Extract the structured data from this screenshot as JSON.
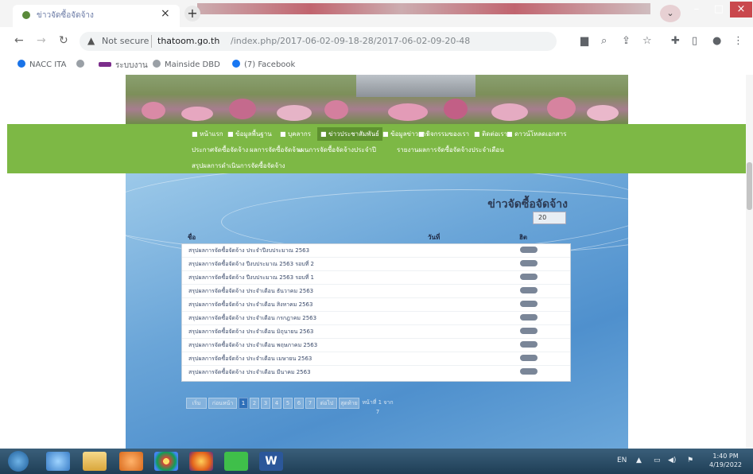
{
  "browser": {
    "tab_title": "ข่าวจัดซื้อจัดจ้าง",
    "tab_close": "×",
    "new_tab": "+",
    "address": {
      "security": "Not secure",
      "host": "thatoom.go.th",
      "path": "/index.php/2017-06-02-09-18-28/2017-06-02-09-20-48"
    },
    "bookmarks": [
      {
        "label": "NACC ITA",
        "color": "#1a73e8"
      },
      {
        "label": "",
        "color": "#9aa0a6"
      },
      {
        "label": "ระบบงาน",
        "color": "#7b2d8b"
      },
      {
        "label": "Mainside DBD",
        "color": "#9aa0a6"
      },
      {
        "label": "(7) Facebook",
        "color": "#1877f2"
      }
    ]
  },
  "site": {
    "menu_row1": [
      {
        "label": "■ หน้าแรก",
        "active": false
      },
      {
        "label": "■ ข้อมูลพื้นฐาน",
        "active": false
      },
      {
        "label": "■ บุคลากร",
        "active": false
      },
      {
        "label": "■ ข่าวประชาสัมพันธ์",
        "active": true
      },
      {
        "label": "■ ข้อมูลข่าวสาร",
        "active": false
      },
      {
        "label": "■ กิจกรรมของเรา",
        "active": false
      },
      {
        "label": "■ ติดต่อเรา",
        "active": false
      },
      {
        "label": "■ ดาวน์โหลดเอกสาร",
        "active": false
      }
    ],
    "menu_row2": [
      "ประกาศจัดซื้อจัดจ้าง",
      "ผลการจัดซื้อจัดจ้าง",
      "แผนการจัดซื้อจัดจ้างประจำปี",
      "รายงานผลการจัดซื้อจัดจ้างประจำเดือน"
    ],
    "menu_row3": [
      "สรุปผลการดำเนินการจัดซื้อจัดจ้าง"
    ],
    "page_title": "ข่าวจัดซื้อจัดจ้าง",
    "display_select": "20",
    "table": {
      "headers": [
        "ชื่อ",
        "วันที่",
        "ฮิต"
      ],
      "rows": [
        {
          "title": "สรุปผลการจัดซื้อจัดจ้าง ประจำปีงบประมาณ 2563",
          "date": "",
          "hits": ""
        },
        {
          "title": "สรุปผลการจัดซื้อจัดจ้าง ปีงบประมาณ 2563 รอบที่ 2",
          "date": "",
          "hits": ""
        },
        {
          "title": "สรุปผลการจัดซื้อจัดจ้าง ปีงบประมาณ 2563 รอบที่ 1",
          "date": "",
          "hits": ""
        },
        {
          "title": "สรุปผลการจัดซื้อจัดจ้าง ประจำเดือน ธันวาคม 2563",
          "date": "",
          "hits": ""
        },
        {
          "title": "สรุปผลการจัดซื้อจัดจ้าง ประจำเดือน สิงหาคม 2563",
          "date": "",
          "hits": ""
        },
        {
          "title": "สรุปผลการจัดซื้อจัดจ้าง ประจำเดือน กรกฎาคม 2563",
          "date": "",
          "hits": ""
        },
        {
          "title": "สรุปผลการจัดซื้อจัดจ้าง ประจำเดือน มิถุนายน 2563",
          "date": "",
          "hits": ""
        },
        {
          "title": "สรุปผลการจัดซื้อจัดจ้าง ประจำเดือน พฤษภาคม 2563",
          "date": "",
          "hits": ""
        },
        {
          "title": "สรุปผลการจัดซื้อจัดจ้าง ประจำเดือน เมษายน 2563",
          "date": "",
          "hits": ""
        },
        {
          "title": "สรุปผลการจัดซื้อจัดจ้าง ประจำเดือน มีนาคม 2563",
          "date": "",
          "hits": ""
        }
      ]
    },
    "pagination": [
      "เริ่ม",
      "ก่อนหน้า",
      "1",
      "2",
      "3",
      "4",
      "5",
      "6",
      "7",
      "ต่อไป",
      "สุดท้าย",
      "หน้าที่ 1 จาก 7"
    ]
  },
  "taskbar": {
    "language": "EN",
    "time": "1:40 PM",
    "date": "4/19/2022"
  },
  "colors": {
    "menu_green": "#7db845",
    "content_blue": "#5b9bd5",
    "taskbar": "#2a4d68"
  }
}
